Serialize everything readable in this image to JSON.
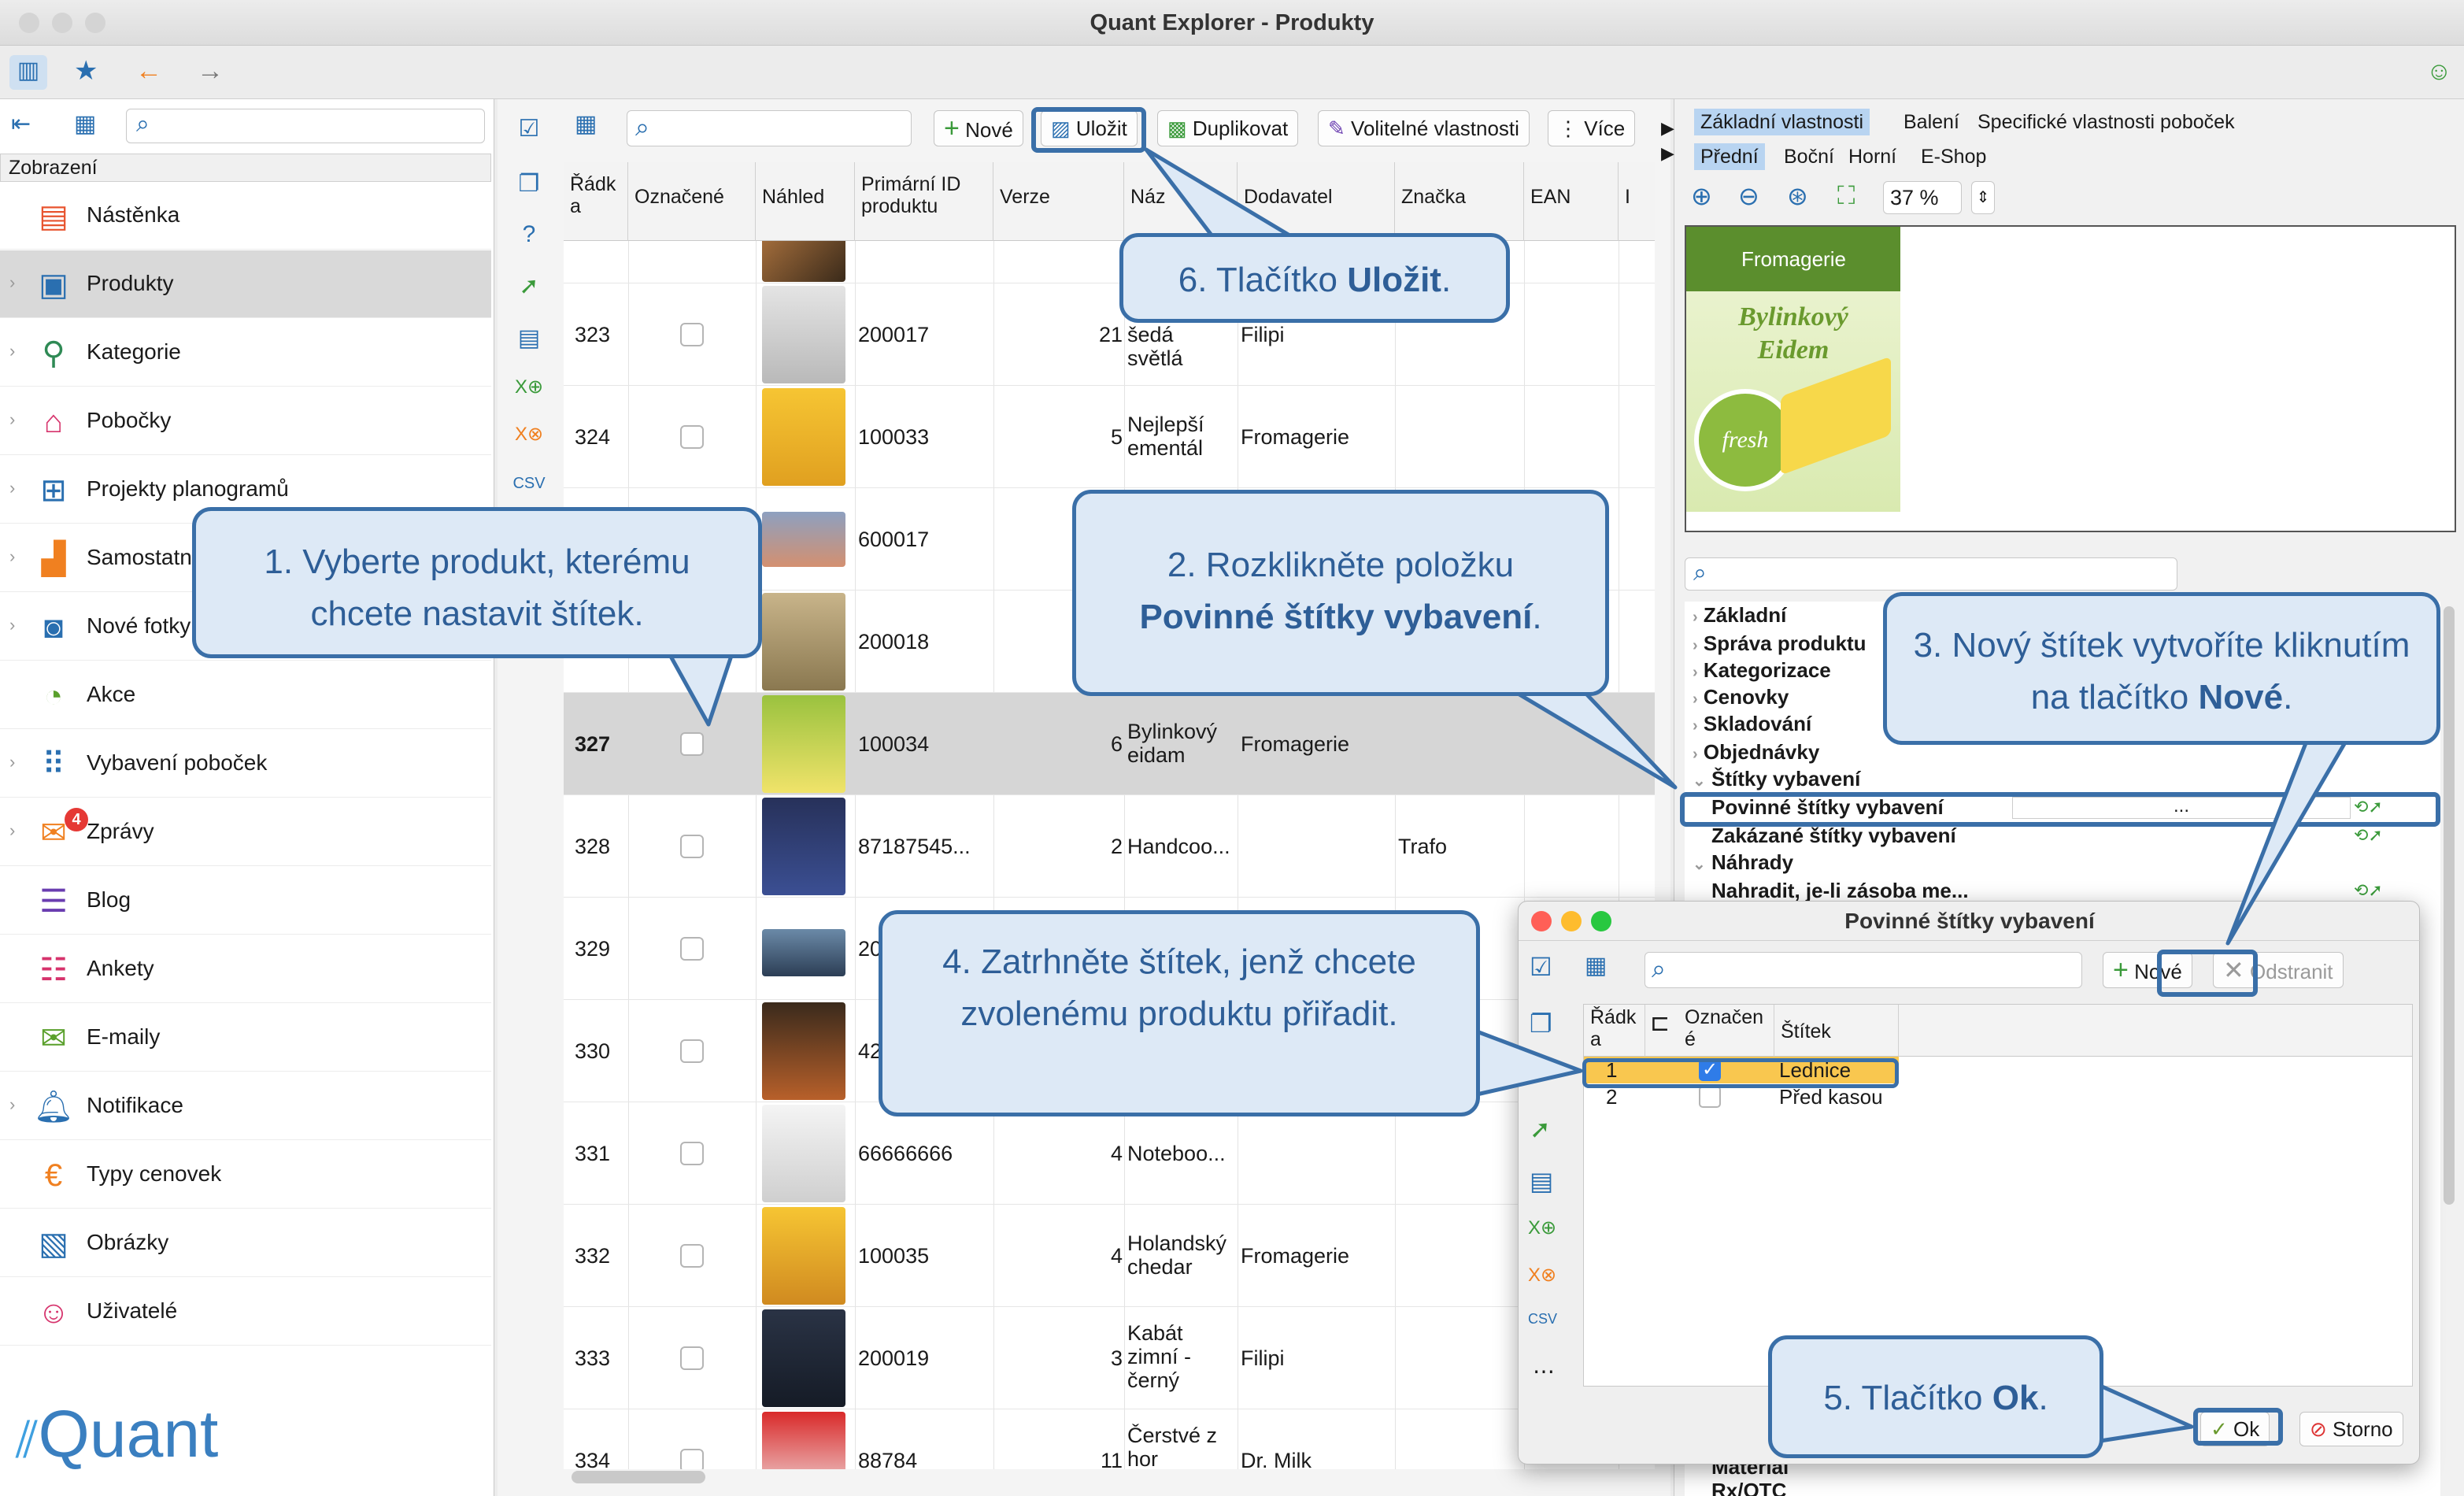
{
  "window": {
    "title": "Quant Explorer - Produkty"
  },
  "left": {
    "zobrazeni": "Zobrazení",
    "items": [
      {
        "label": "Nástěnka"
      },
      {
        "label": "Produkty"
      },
      {
        "label": "Kategorie"
      },
      {
        "label": "Pobočky"
      },
      {
        "label": "Projekty planogramů"
      },
      {
        "label": "Samostatn"
      },
      {
        "label": "Nové fotky"
      },
      {
        "label": "Akce"
      },
      {
        "label": "Vybavení poboček"
      },
      {
        "label": "Zprávy",
        "badge": "4"
      },
      {
        "label": "Blog"
      },
      {
        "label": "Ankety"
      },
      {
        "label": "E-maily"
      },
      {
        "label": "Notifikace"
      },
      {
        "label": "Typy cenovek"
      },
      {
        "label": "Obrázky"
      },
      {
        "label": "Uživatelé"
      }
    ],
    "logo": "Quant"
  },
  "toolbar": {
    "nove": "Nové",
    "ulozit": "Uložit",
    "duplikovat": "Duplikovat",
    "volitelne": "Volitelné vlastnosti",
    "vice": "Více"
  },
  "table": {
    "headers": [
      "Řádk a",
      "Označené",
      "Náhled",
      "Primární ID produktu",
      "Verze",
      "Náz",
      "Dodavatel",
      "Značka",
      "EAN",
      "I"
    ],
    "rows": [
      {
        "radek": "323",
        "id": "200017",
        "verze": "21",
        "nazev": "šedá světlá",
        "dodavatel": "Filipi",
        "znacka": ""
      },
      {
        "radek": "324",
        "id": "100033",
        "verze": "5",
        "nazev": "Nejlepší ementál",
        "dodavatel": "Fromagerie",
        "znacka": ""
      },
      {
        "radek": "",
        "id": "600017",
        "verze": "",
        "nazev": "",
        "dodavatel": "",
        "znacka": ""
      },
      {
        "radek": "",
        "id": "200018",
        "verze": "",
        "nazev": "",
        "dodavatel": "",
        "znacka": ""
      },
      {
        "radek": "327",
        "id": "100034",
        "verze": "6",
        "nazev": "Bylinkový eidam",
        "dodavatel": "Fromagerie",
        "znacka": ""
      },
      {
        "radek": "328",
        "id": "87187545...",
        "verze": "2",
        "nazev": "Handcoo...",
        "dodavatel": "",
        "znacka": "Trafo"
      },
      {
        "radek": "329",
        "id": "20",
        "verze": "",
        "nazev": "",
        "dodavatel": "",
        "znacka": ""
      },
      {
        "radek": "330",
        "id": "42",
        "verze": "",
        "nazev": "",
        "dodavatel": "",
        "znacka": ""
      },
      {
        "radek": "331",
        "id": "66666666",
        "verze": "4",
        "nazev": "Noteboo...",
        "dodavatel": "",
        "znacka": ""
      },
      {
        "radek": "332",
        "id": "100035",
        "verze": "4",
        "nazev": "Holandský chedar",
        "dodavatel": "Fromagerie",
        "znacka": ""
      },
      {
        "radek": "333",
        "id": "200019",
        "verze": "3",
        "nazev": "Kabát zimní - černý",
        "dodavatel": "Filipi",
        "znacka": ""
      },
      {
        "radek": "334",
        "id": "88784",
        "verze": "11",
        "nazev": "Čerstvé z hor",
        "dodavatel": "Dr. Milk",
        "znacka": ""
      }
    ]
  },
  "right": {
    "tabs1": [
      "Základní vlastnosti",
      "Balení",
      "Specifické vlastnosti poboček"
    ],
    "tabs2": [
      "Přední",
      "Boční",
      "Horní",
      "E-Shop"
    ],
    "zoom": "37 %",
    "preview": {
      "brand": "Fromagerie",
      "name1": "Bylinkový",
      "name2": "Eidem",
      "seal": "fresh"
    },
    "props": [
      "Základní",
      "Správa produktu",
      "Kategorizace",
      "Cenovky",
      "Skladování",
      "Objednávky",
      "Štítky vybavení",
      "Povinné štítky vybavení",
      "Zakázané štítky vybavení",
      "Náhrady",
      "Nahradit, je-li zásoba me...",
      "Materiál",
      "Rx/OTC"
    ],
    "dots": "..."
  },
  "dialog": {
    "title": "Povinné štítky vybavení",
    "nove": "Nové",
    "odstranit": "Odstranit",
    "headers": [
      "Řádk a",
      "Označen é",
      "Štítek"
    ],
    "rows": [
      {
        "n": "1",
        "label": "Lednice",
        "checked": true
      },
      {
        "n": "2",
        "label": "Před kasou",
        "checked": false
      }
    ],
    "ok": "Ok",
    "storno": "Storno"
  },
  "callouts": {
    "c1": "1. Vyberte produkt, kterému chcete nastavit štítek.",
    "c2a": "2. Rozklikněte položku",
    "c2b": "Povinné štítky vybavení",
    "c3a": "3. Nový štítek vytvoříte kliknutím na tlačítko",
    "c3b": "Nové",
    "c4": "4. Zatrhněte štítek, jenž chcete zvolenému produktu přiřadit.",
    "c5a": "5. Tlačítko",
    "c5b": "Ok",
    "c6a": "6. Tlačítko",
    "c6b": "Uložit"
  }
}
